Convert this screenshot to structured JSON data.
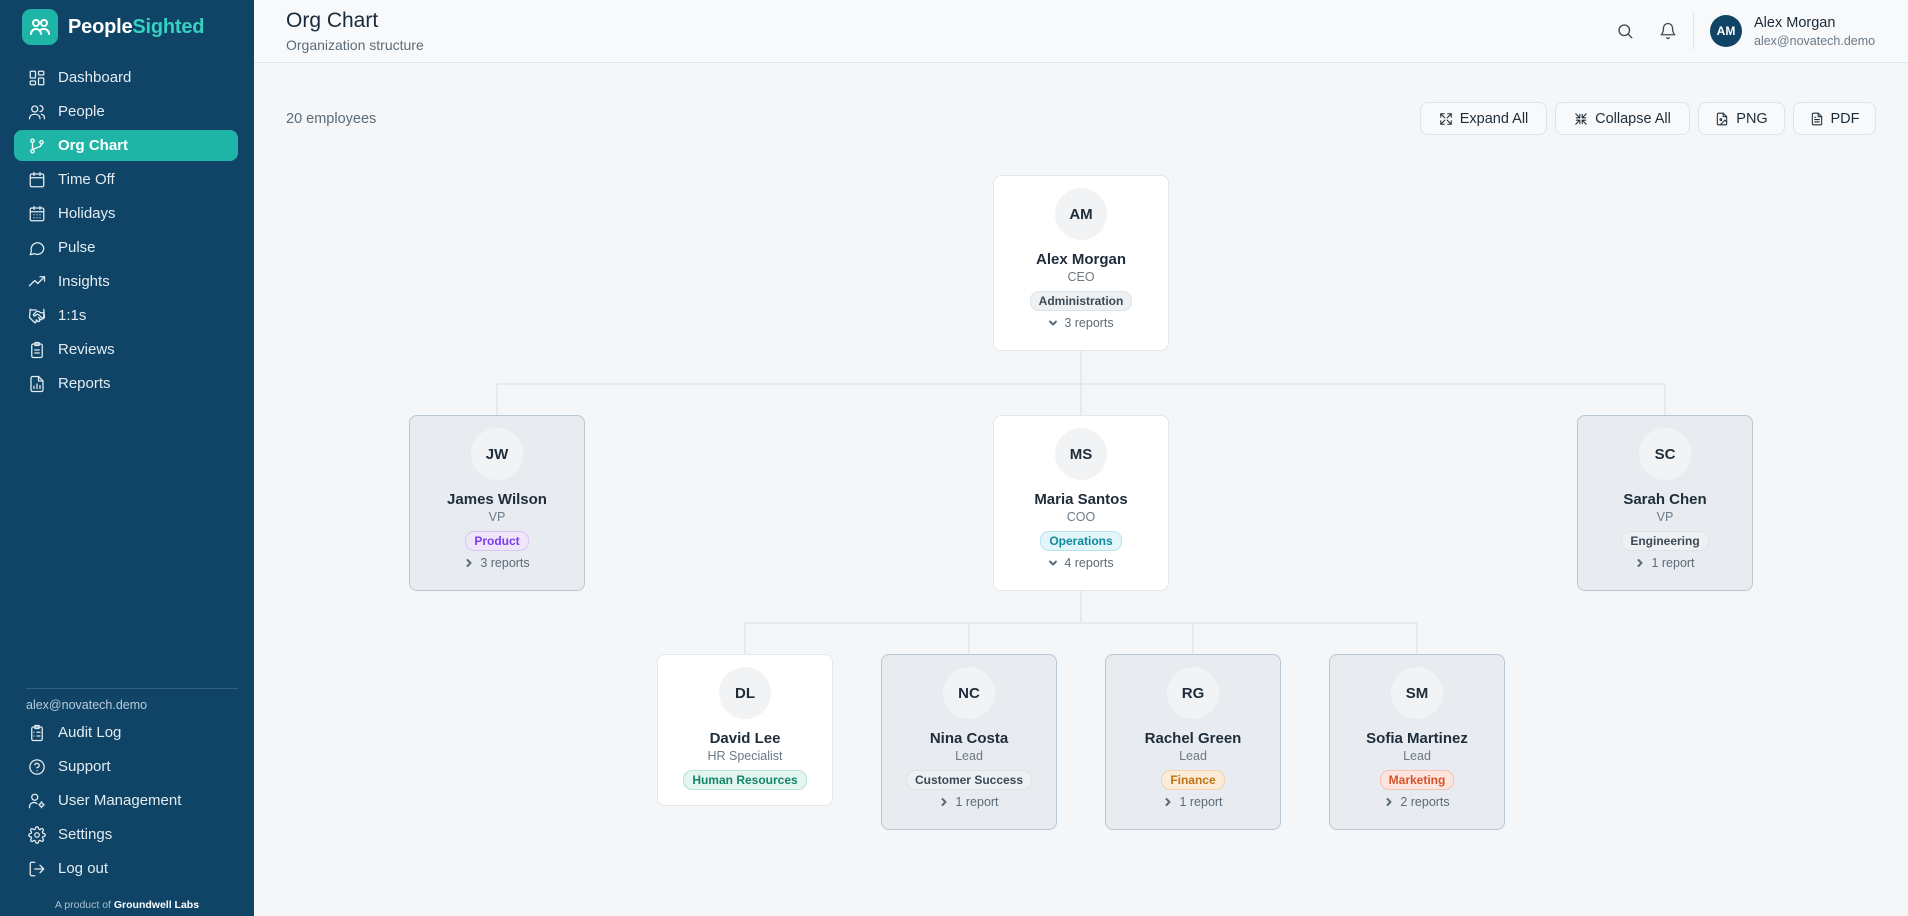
{
  "brand": {
    "part1": "People",
    "part2": "Sighted"
  },
  "sidebar": {
    "items": [
      {
        "label": "Dashboard",
        "icon": "dashboard-icon"
      },
      {
        "label": "People",
        "icon": "people-icon"
      },
      {
        "label": "Org Chart",
        "icon": "org-chart-icon",
        "active": true
      },
      {
        "label": "Time Off",
        "icon": "calendar-icon"
      },
      {
        "label": "Holidays",
        "icon": "calendar-days-icon"
      },
      {
        "label": "Pulse",
        "icon": "chat-bubble-icon"
      },
      {
        "label": "Insights",
        "icon": "trend-up-icon"
      },
      {
        "label": "1:1s",
        "icon": "handshake-icon"
      },
      {
        "label": "Reviews",
        "icon": "clipboard-icon"
      },
      {
        "label": "Reports",
        "icon": "report-icon"
      }
    ],
    "account_email": "alex@novatech.demo",
    "bottom_items": [
      {
        "label": "Audit Log",
        "icon": "clipboard-list-icon"
      },
      {
        "label": "Support",
        "icon": "help-circle-icon"
      },
      {
        "label": "User Management",
        "icon": "user-cog-icon"
      },
      {
        "label": "Settings",
        "icon": "gear-icon"
      },
      {
        "label": "Log out",
        "icon": "logout-icon"
      }
    ],
    "footer_prefix": "A product of ",
    "footer_company": "Groundwell Labs"
  },
  "header": {
    "title": "Org Chart",
    "subtitle": "Organization structure",
    "user": {
      "initials": "AM",
      "name": "Alex Morgan",
      "email": "alex@novatech.demo"
    }
  },
  "toolbar": {
    "employee_count": "20 employees",
    "expand_all": "Expand All",
    "collapse_all": "Collapse All",
    "png": "PNG",
    "pdf": "PDF"
  },
  "org": [
    {
      "id": "am",
      "initials": "AM",
      "name": "Alex Morgan",
      "role": "CEO",
      "department": "Administration",
      "reports": "3 reports",
      "expanded": true
    },
    {
      "id": "jw",
      "initials": "JW",
      "name": "James Wilson",
      "role": "VP",
      "department": "Product",
      "reports": "3 reports",
      "expanded": false
    },
    {
      "id": "ms",
      "initials": "MS",
      "name": "Maria Santos",
      "role": "COO",
      "department": "Operations",
      "reports": "4 reports",
      "expanded": true
    },
    {
      "id": "sc",
      "initials": "SC",
      "name": "Sarah Chen",
      "role": "VP",
      "department": "Engineering",
      "reports": "1 report",
      "expanded": false
    },
    {
      "id": "dl",
      "initials": "DL",
      "name": "David Lee",
      "role": "HR Specialist",
      "department": "Human Resources",
      "reports": "",
      "expanded": true
    },
    {
      "id": "nc",
      "initials": "NC",
      "name": "Nina Costa",
      "role": "Lead",
      "department": "Customer Success",
      "reports": "1 report",
      "expanded": false
    },
    {
      "id": "rg",
      "initials": "RG",
      "name": "Rachel Green",
      "role": "Lead",
      "department": "Finance",
      "reports": "1 report",
      "expanded": false
    },
    {
      "id": "sm",
      "initials": "SM",
      "name": "Sofia Martinez",
      "role": "Lead",
      "department": "Marketing",
      "reports": "2 reports",
      "expanded": false
    }
  ],
  "department_colors": {
    "Administration": {
      "bg": "#eef1f4",
      "fg": "#3b4a57",
      "border": "#dde3e8"
    },
    "Product": {
      "bg": "#efe6fb",
      "fg": "#7c3aed",
      "border": "#d9c6f5"
    },
    "Operations": {
      "bg": "#e2f5f8",
      "fg": "#0e8aa0",
      "border": "#b6e3eb"
    },
    "Engineering": {
      "bg": "#eef1f4",
      "fg": "#3b4a57",
      "border": "#dde3e8"
    },
    "Human Resources": {
      "bg": "#e3f5ee",
      "fg": "#14866a",
      "border": "#b8e3d3"
    },
    "Customer Success": {
      "bg": "#eef1f4",
      "fg": "#3b4a57",
      "border": "#dde3e8"
    },
    "Finance": {
      "bg": "#fbecd9",
      "fg": "#c27314",
      "border": "#f0d2a8"
    },
    "Marketing": {
      "bg": "#fde4dc",
      "fg": "#d4532b",
      "border": "#f5c3b2"
    }
  }
}
